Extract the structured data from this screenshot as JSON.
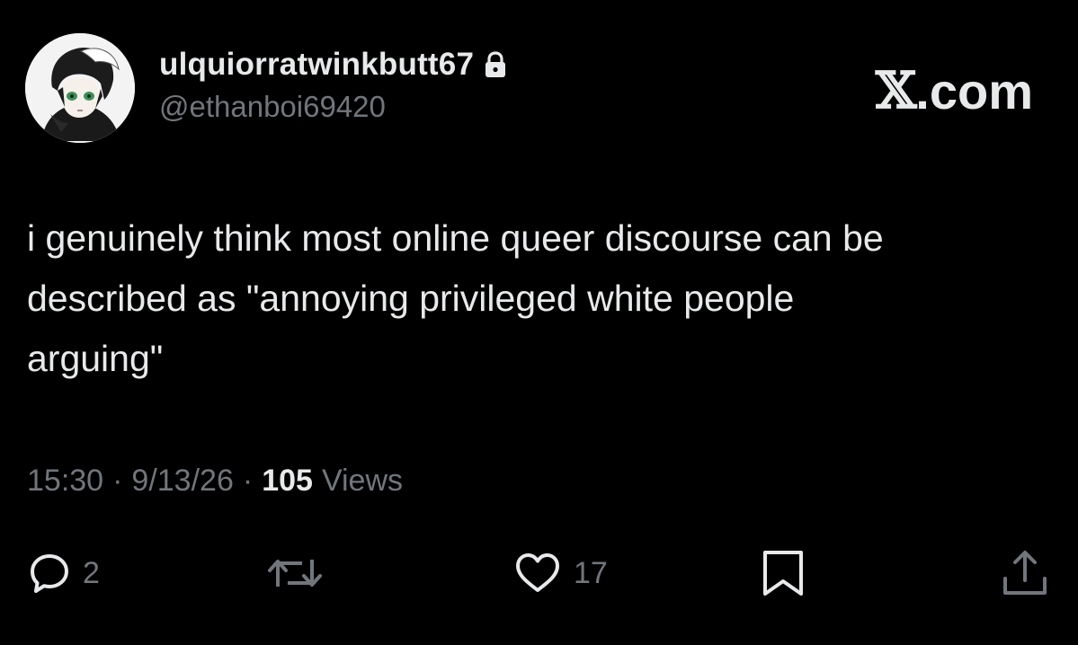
{
  "user": {
    "display_name": "ulquiorratwinkbutt67",
    "handle": "@ethanboi69420",
    "protected_icon": "lock-icon"
  },
  "brand": {
    "x_glyph": "𝕏",
    "domain": ".com"
  },
  "tweet": {
    "text": "i genuinely think most online queer discourse can be\ndescribed as \"annoying privileged white people\narguing\""
  },
  "meta": {
    "time": "15:30",
    "separator": "·",
    "date": "9/13/26",
    "views_count": "105",
    "views_label": "Views"
  },
  "actions": {
    "reply": {
      "icon": "reply-icon",
      "count": "2"
    },
    "repost": {
      "icon": "repost-icon"
    },
    "like": {
      "icon": "heart-icon",
      "count": "17"
    },
    "bookmark": {
      "icon": "bookmark-icon"
    },
    "share": {
      "icon": "share-icon"
    }
  },
  "colors": {
    "background": "#000000",
    "primary_text": "#e7e9ea",
    "secondary_text": "#71767b"
  }
}
